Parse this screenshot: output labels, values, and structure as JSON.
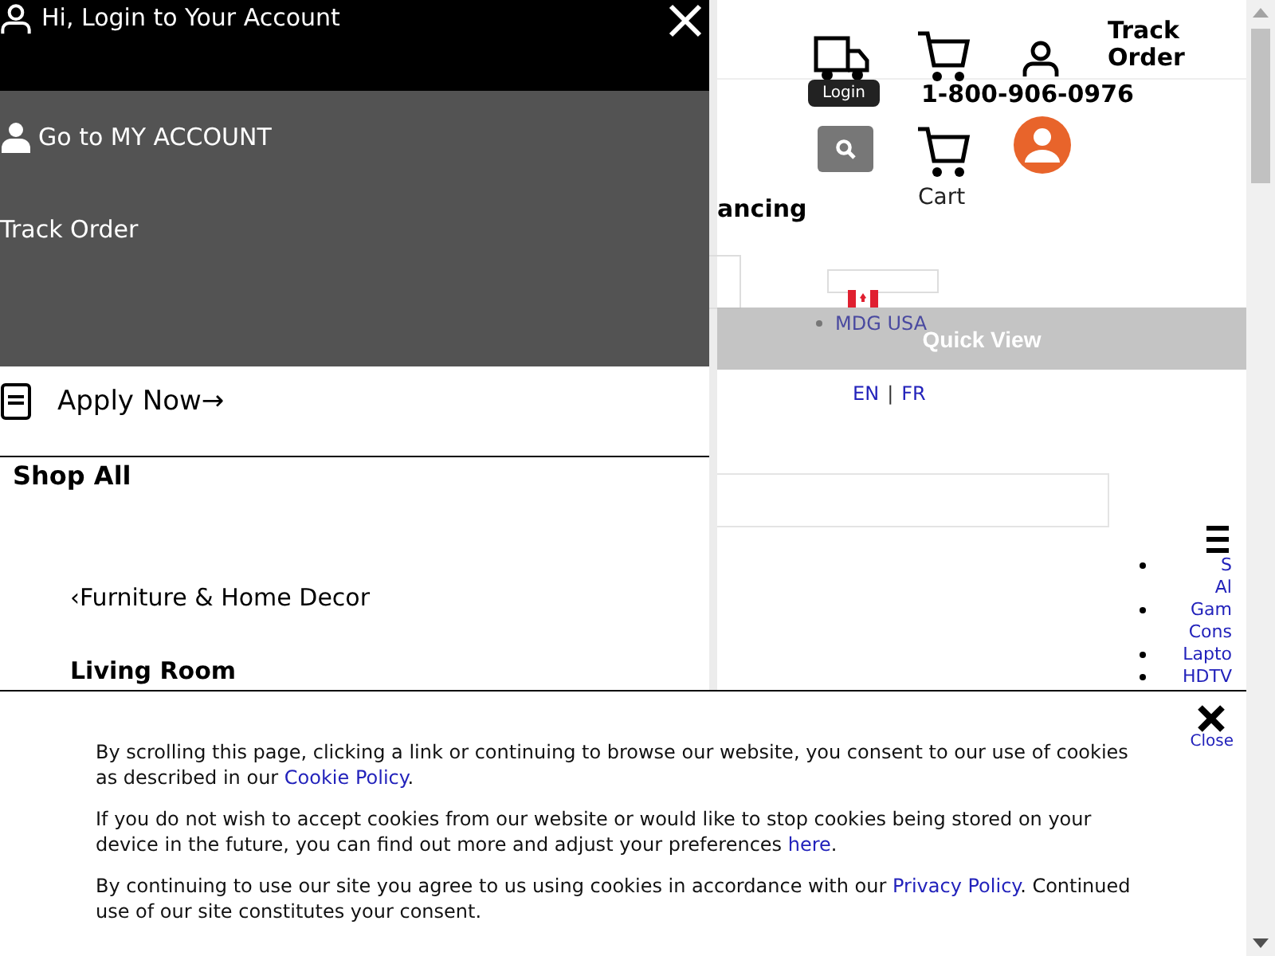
{
  "drawer": {
    "title": "Hi, Login to Your Account",
    "account_links": [
      {
        "label": "Go to MY ACCOUNT",
        "kind": "account"
      },
      {
        "label": "Track Order",
        "kind": "plain"
      }
    ],
    "apply": "Apply Now→",
    "section_title": "Shop All",
    "back_link": "‹Furniture & Home Decor",
    "subsection": "Living Room"
  },
  "header": {
    "track_order": [
      "Track",
      "Order"
    ],
    "tooltip": "Login",
    "phone": "1-800-906-0976",
    "cart_label": "Cart",
    "financing": "ancing"
  },
  "region": {
    "country": "MDG USA",
    "languages": [
      "EN",
      "FR"
    ],
    "separator": "|"
  },
  "quick_view": "Quick View",
  "side_menu": [
    {
      "lines": [
        "S",
        "Al"
      ]
    },
    {
      "lines": [
        "Gam",
        "Cons"
      ]
    },
    {
      "lines": [
        "Lapto"
      ]
    },
    {
      "lines": [
        "HDTV"
      ]
    }
  ],
  "cookie_banner": {
    "paragraphs": [
      [
        {
          "kind": "text",
          "text": "By scrolling this page, clicking a link or continuing to browse our website, you consent to our use of cookies as described in our "
        },
        {
          "kind": "link",
          "text": "Cookie Policy"
        },
        {
          "kind": "text",
          "text": "."
        }
      ],
      [
        {
          "kind": "text",
          "text": "If you do not wish to accept cookies from our website or would like to stop cookies being stored on your device in the future, you can find out more and adjust your preferences "
        },
        {
          "kind": "link",
          "text": "here"
        },
        {
          "kind": "text",
          "text": "."
        }
      ],
      [
        {
          "kind": "text",
          "text": "By continuing to use our site you agree to us using cookies in accordance with our "
        },
        {
          "kind": "link",
          "text": "Privacy Policy"
        },
        {
          "kind": "text",
          "text": ". Continued use of our site constitutes your consent."
        }
      ]
    ],
    "close": "Close"
  }
}
